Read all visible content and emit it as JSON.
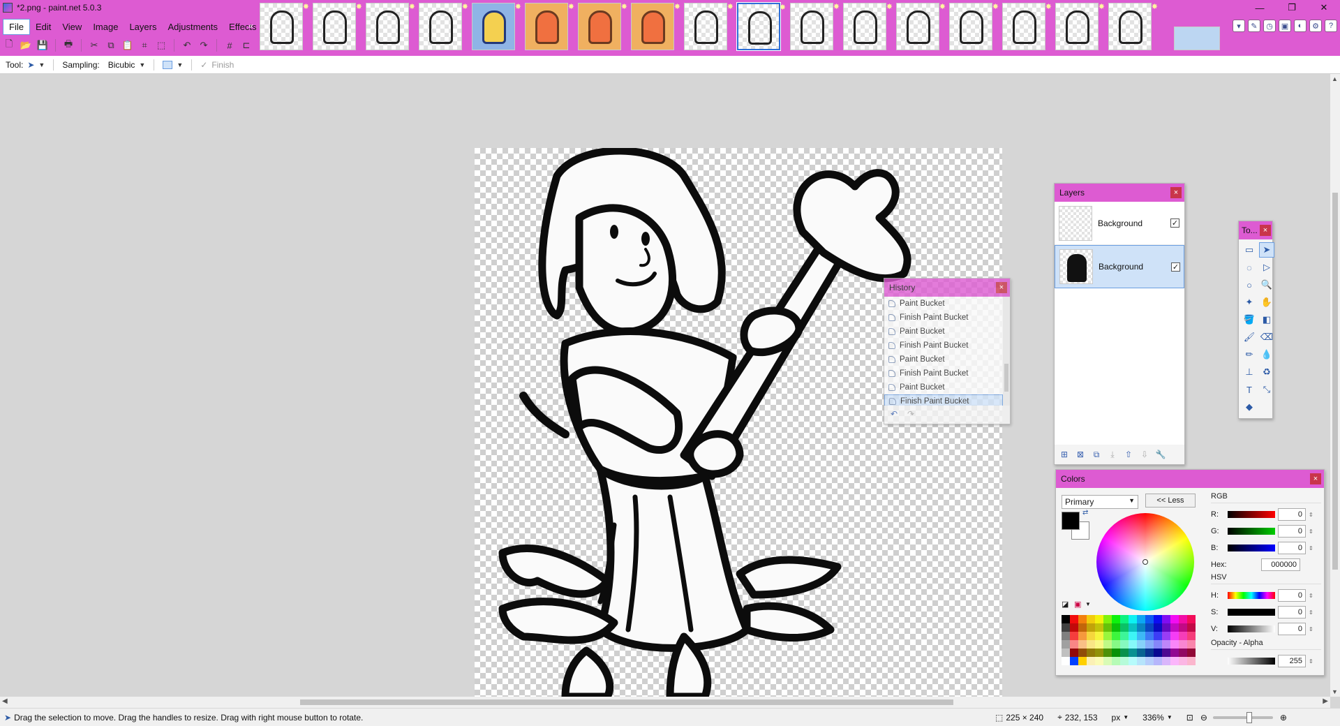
{
  "window": {
    "title": "*2.png - paint.net 5.0.3",
    "controls": {
      "minimize": "—",
      "restore": "❐",
      "close": "✕"
    }
  },
  "menu": {
    "items": [
      {
        "label": "File",
        "active": true
      },
      {
        "label": "Edit"
      },
      {
        "label": "View"
      },
      {
        "label": "Image"
      },
      {
        "label": "Layers"
      },
      {
        "label": "Adjustments"
      },
      {
        "label": "Effects"
      }
    ]
  },
  "toolbar": {
    "icons": [
      "new-icon",
      "open-icon",
      "save-icon",
      "print-icon",
      "cut-icon",
      "copy-icon",
      "paste-icon",
      "crop-icon",
      "deselect-icon",
      "undo-icon",
      "redo-icon",
      "grid-icon",
      "ruler-icon"
    ]
  },
  "image_strip": {
    "thumbnail_count": 17,
    "selected_index": 9
  },
  "tool_options": {
    "tool_label": "Tool:",
    "sampling_label": "Sampling:",
    "sampling_value": "Bicubic",
    "finish_label": "Finish"
  },
  "history": {
    "title": "History",
    "items": [
      {
        "label": "Paint Bucket"
      },
      {
        "label": "Finish Paint Bucket"
      },
      {
        "label": "Paint Bucket"
      },
      {
        "label": "Finish Paint Bucket"
      },
      {
        "label": "Paint Bucket"
      },
      {
        "label": "Finish Paint Bucket"
      },
      {
        "label": "Paint Bucket"
      },
      {
        "label": "Finish Paint Bucket",
        "selected": true
      }
    ]
  },
  "layers": {
    "title": "Layers",
    "items": [
      {
        "name": "Background",
        "visible": true,
        "selected": false
      },
      {
        "name": "Background",
        "visible": true,
        "selected": true
      }
    ]
  },
  "tools": {
    "title": "To..."
  },
  "colors": {
    "title": "Colors",
    "mode": "Primary",
    "less_label": "<< Less",
    "rgb_heading": "RGB",
    "hsv_heading": "HSV",
    "r_label": "R:",
    "r_value": "0",
    "g_label": "G:",
    "g_value": "0",
    "b_label": "B:",
    "b_value": "0",
    "hex_label": "Hex:",
    "hex_value": "000000",
    "h_label": "H:",
    "h_value": "0",
    "s_label": "S:",
    "s_value": "0",
    "v_label": "V:",
    "v_value": "0",
    "opacity_heading": "Opacity - Alpha",
    "alpha_value": "255",
    "primary_color": "#000000",
    "secondary_color": "#ffffff"
  },
  "status": {
    "hint": "Drag the selection to move. Drag the handles to resize. Drag with right mouse button to rotate.",
    "selection_size": "225 × 240",
    "cursor_position": "232, 153",
    "units": "px",
    "zoom": "336%"
  },
  "theme": {
    "accent": "#dd5bd2",
    "selection_blue": "#cfe2f8",
    "close_red": "#c9354b"
  }
}
